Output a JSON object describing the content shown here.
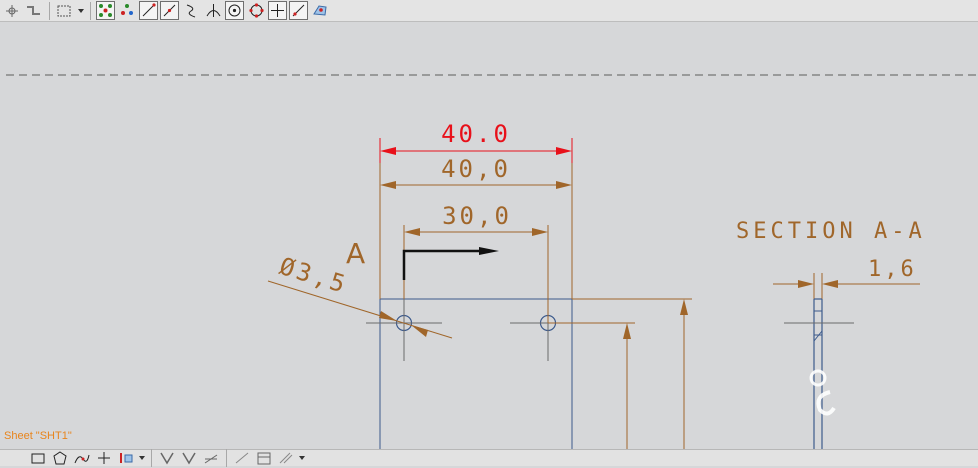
{
  "toolbar": {
    "tools": [
      {
        "icon": "snap-point-icon"
      },
      {
        "icon": "stepped-line-icon"
      },
      {
        "icon": "selection-box-icon"
      },
      {
        "icon": "snap-endpoint-icon"
      },
      {
        "icon": "snap-midpoint-icon"
      },
      {
        "icon": "snap-line-icon"
      },
      {
        "icon": "snap-tangent-icon"
      },
      {
        "icon": "snap-curve-icon"
      },
      {
        "icon": "snap-perpendicular-icon"
      },
      {
        "icon": "snap-center-icon"
      },
      {
        "icon": "snap-quadrant-icon"
      },
      {
        "icon": "snap-intersection-icon"
      },
      {
        "icon": "snap-on-curve-icon"
      },
      {
        "icon": "snap-face-icon"
      }
    ]
  },
  "drawing": {
    "dimensions": {
      "top_dim_red": "40.0",
      "width_dim": "40,0",
      "hole_spacing": "30,0",
      "hole_diameter": "Ø3,5",
      "section_thickness": "1,6"
    },
    "section_letter": "A",
    "section_title": "SECTION A-A"
  },
  "status": {
    "sheet_label": "Sheet \"SHT1\""
  },
  "colors": {
    "dimension": "#a0662a",
    "highlight": "#e8101a",
    "geometry": "#3c5a8c",
    "background": "#d6d7d9"
  }
}
